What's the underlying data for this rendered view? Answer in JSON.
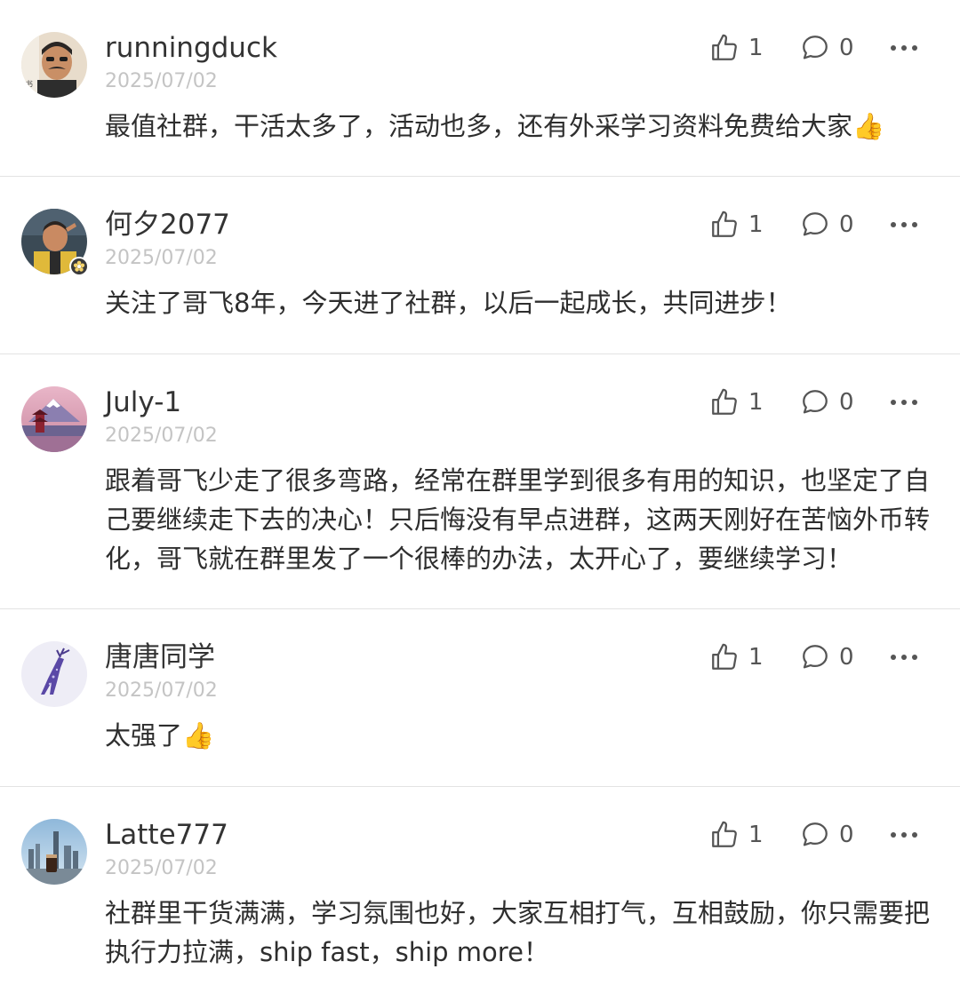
{
  "comments": [
    {
      "username": "runningduck",
      "date": "2025/07/02",
      "text": "最值社群，干活太多了，活动也多，还有外采学习资料免费给大家👍",
      "likes": "1",
      "replies": "0",
      "avatar_icon": "avatar-man-mustache"
    },
    {
      "username": "何夕2077",
      "date": "2025/07/02",
      "text": "关注了哥飞8年，今天进了社群，以后一起成长，共同进步！",
      "likes": "1",
      "replies": "0",
      "avatar_icon": "avatar-cartoon-saluting"
    },
    {
      "username": "July-1",
      "date": "2025/07/02",
      "text": "跟着哥飞少走了很多弯路，经常在群里学到很多有用的知识，也坚定了自己要继续走下去的决心！只后悔没有早点进群，这两天刚好在苦恼外币转化，哥飞就在群里发了一个很棒的办法，太开心了，要继续学习！",
      "likes": "1",
      "replies": "0",
      "avatar_icon": "avatar-mount-fuji-pagoda"
    },
    {
      "username": "唐唐同学",
      "date": "2025/07/02",
      "text": "太强了👍",
      "likes": "1",
      "replies": "0",
      "avatar_icon": "avatar-purple-deer"
    },
    {
      "username": "Latte777",
      "date": "2025/07/02",
      "text": "社群里干货满满，学习氛围也好，大家互相打气，互相鼓励，你只需要把执行力拉满，ship fast，ship more！",
      "likes": "1",
      "replies": "0",
      "avatar_icon": "avatar-city-skyline-coffee"
    }
  ]
}
